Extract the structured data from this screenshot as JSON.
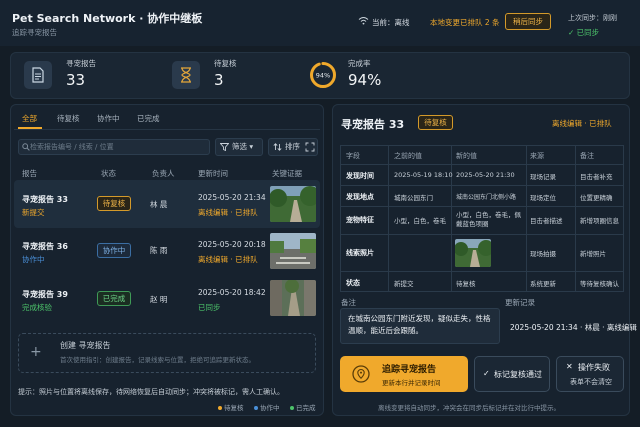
{
  "header": {
    "title": "Pet Search Network · 协作中继板",
    "subtitle": "追踪寻宠报告",
    "connection": "当前：离线",
    "pending": "本地变更已排队 2 条",
    "sync_button": "稍后同步",
    "last_sync_label": "上次同步：刚刚",
    "synced": "已同步"
  },
  "stats": [
    {
      "label": "寻宠报告",
      "value": "33",
      "icon": "document-icon"
    },
    {
      "label": "待复核",
      "value": "3",
      "icon": "hourglass-icon"
    },
    {
      "label": "完成率",
      "value": "94%",
      "ring_label": "94%",
      "fraction": 0.94
    }
  ],
  "tabs": [
    "全部",
    "待复核",
    "协作中",
    "已完成"
  ],
  "search": {
    "placeholder": "检索报告编号 / 线索 / 位置"
  },
  "filter": "筛选",
  "sort": "排序",
  "columns": [
    "报告",
    "状态",
    "负责人",
    "更新时间",
    "关键证据"
  ],
  "rows": [
    {
      "name": "寻宠报告 33",
      "state": "新提交",
      "badge": "待复核",
      "owner": "林 晨",
      "time": "2025-05-20 21:34",
      "sync": "离线编辑 · 已排队"
    },
    {
      "name": "寻宠报告 36",
      "state": "协作中",
      "badge": "协作中",
      "owner": "陈 雨",
      "time": "2025-05-20 20:18",
      "sync": "离线编辑 · 已排队"
    },
    {
      "name": "寻宠报告 39",
      "state": "完成核验",
      "badge": "已完成",
      "owner": "赵 明",
      "time": "2025-05-20 18:42",
      "sync": "已同步"
    }
  ],
  "create": {
    "title": "创建 寻宠报告",
    "desc": "首次使用指引：创建报告，记录线索与位置，拒绝可追踪更新状态。"
  },
  "hint": "提示：照片与位置将离线保存，待网络恢复后自动同步；冲突将被标记，需人工确认。",
  "legend": [
    "待复核",
    "协作中",
    "已完成"
  ],
  "detail": {
    "title": "寻宠报告 33",
    "badge": "待复核",
    "offline": "离线编辑 · 已排队",
    "headers": [
      "字段",
      "之前的值",
      "新的值",
      "来源",
      "备注"
    ],
    "rows": [
      [
        "发现时间",
        "2025-05-19 18:10",
        "2025-05-20 21:30",
        "现场记录",
        "目击者补充"
      ],
      [
        "发现地点",
        "城南公园东门",
        "城南公园东门北侧小路",
        "现场定位",
        "位置更精确"
      ],
      [
        "宠物特征",
        "小型，白色，卷毛",
        "小型，白色，卷毛，佩戴蓝色项圈",
        "目击者描述",
        "新增项圈信息"
      ],
      [
        "线索照片",
        "",
        "",
        "现场拍摄",
        "新增照片"
      ],
      [
        "状态",
        "新提交",
        "待复核",
        "系统更新",
        "等待复核确认"
      ]
    ],
    "note_label": "备注",
    "note": "在城南公园东门附近发现，疑似走失，性格温顺，能近后会跟随。",
    "updated_label": "更新记录",
    "updated": "2025-05-20 21:34 · 林晨 · 离线编辑",
    "primary_title": "追踪寻宠报告",
    "primary_sub": "更新本行并记录时间",
    "mark_reviewed": "标记复核通过",
    "fail_title": "操作失败",
    "fail_sub": "表单不会清空",
    "footer": "离线变更将自动同步，冲突会在同步后标记并在对比行中提示。"
  },
  "colors": {
    "accent": "#f0a92c",
    "ok": "#4cc36a",
    "info": "#4a90d9"
  }
}
